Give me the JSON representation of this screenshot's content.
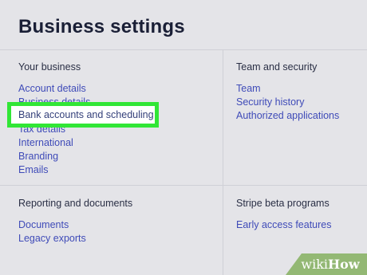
{
  "page": {
    "title": "Business settings"
  },
  "sections": {
    "your_business": {
      "heading": "Your business",
      "links": [
        "Account details",
        "Business details",
        "Bank accounts and scheduling",
        "Tax details",
        "International",
        "Branding",
        "Emails"
      ]
    },
    "team_security": {
      "heading": "Team and security",
      "links": [
        "Team",
        "Security history",
        "Authorized applications"
      ]
    },
    "reporting": {
      "heading": "Reporting and documents",
      "links": [
        "Documents",
        "Legacy exports"
      ]
    },
    "beta": {
      "heading": "Stripe beta programs",
      "links": [
        "Early access features"
      ]
    }
  },
  "watermark": {
    "wiki": "wiki",
    "how": "How"
  },
  "colors": {
    "link": "#3f4bb8",
    "highlight": "#31e636",
    "background": "#e4e4e8"
  }
}
